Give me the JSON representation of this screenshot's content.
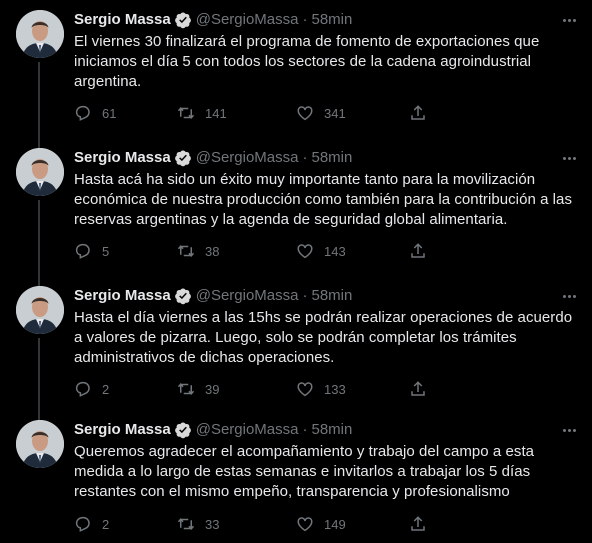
{
  "colors": {
    "background": "#000000",
    "text_primary": "#e7e9ea",
    "text_secondary": "#71767b",
    "thread_line": "#333639",
    "verified": "#1d9bf0"
  },
  "tweets": [
    {
      "author_name": "Sergio Massa",
      "handle": "@SergioMassa",
      "separator": "·",
      "time": "58min",
      "text": "El viernes 30 finalizará el programa de fomento de exportaciones que iniciamos el día 5 con todos los sectores de la cadena agroindustrial argentina.",
      "replies": "61",
      "retweets": "141",
      "likes": "341"
    },
    {
      "author_name": "Sergio Massa",
      "handle": "@SergioMassa",
      "separator": "·",
      "time": "58min",
      "text": "Hasta acá ha sido un éxito muy importante tanto para la movilización económica de nuestra producción como también para la contribución a las reservas argentinas y la agenda de seguridad global alimentaria.",
      "replies": "5",
      "retweets": "38",
      "likes": "143"
    },
    {
      "author_name": "Sergio Massa",
      "handle": "@SergioMassa",
      "separator": "·",
      "time": "58min",
      "text": "Hasta el día viernes a las 15hs se podrán realizar operaciones de acuerdo a valores de pizarra. Luego, solo se podrán completar los trámites administrativos de dichas operaciones.",
      "replies": "2",
      "retweets": "39",
      "likes": "133"
    },
    {
      "author_name": "Sergio Massa",
      "handle": "@SergioMassa",
      "separator": "·",
      "time": "58min",
      "text": "Queremos agradecer el acompañamiento y trabajo del campo a esta medida a lo largo de estas semanas e invitarlos a trabajar los 5 días restantes con el mismo empeño, transparencia y profesionalismo",
      "replies": "2",
      "retweets": "33",
      "likes": "149"
    }
  ]
}
